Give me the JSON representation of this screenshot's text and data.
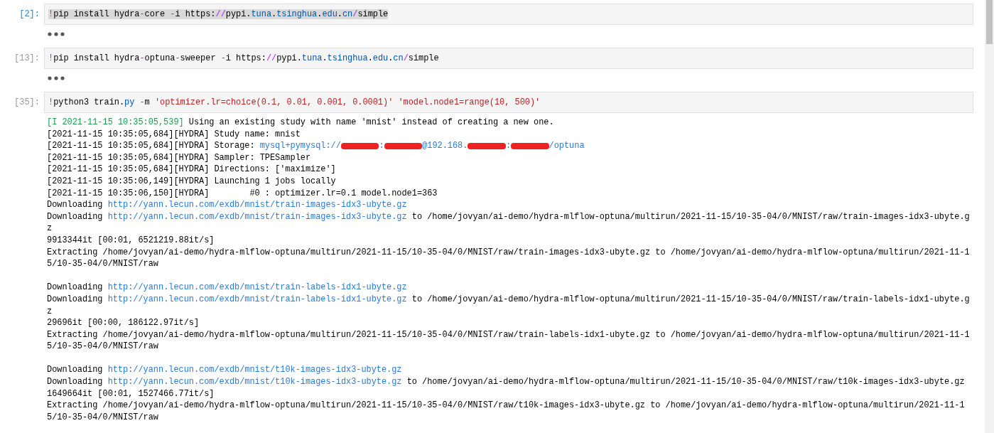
{
  "cells": [
    {
      "prompt": "[2]:",
      "selected": true,
      "code": [
        {
          "kind": "op",
          "text": "!"
        },
        {
          "kind": "plain",
          "text": "pip install hydra"
        },
        {
          "kind": "op",
          "text": "-"
        },
        {
          "kind": "plain",
          "text": "core "
        },
        {
          "kind": "op",
          "text": "-"
        },
        {
          "kind": "plain",
          "text": "i https:"
        },
        {
          "kind": "op",
          "text": "//"
        },
        {
          "kind": "plain",
          "text": "pypi."
        },
        {
          "kind": "name",
          "text": "tuna"
        },
        {
          "kind": "plain",
          "text": "."
        },
        {
          "kind": "name",
          "text": "tsinghua"
        },
        {
          "kind": "plain",
          "text": "."
        },
        {
          "kind": "name",
          "text": "edu"
        },
        {
          "kind": "plain",
          "text": "."
        },
        {
          "kind": "name",
          "text": "cn"
        },
        {
          "kind": "op",
          "text": "/"
        },
        {
          "kind": "plain",
          "text": "simple"
        }
      ],
      "output": {
        "collapsed": true
      }
    },
    {
      "prompt": "[13]:",
      "selected": false,
      "code": [
        {
          "kind": "op",
          "text": "!"
        },
        {
          "kind": "plain",
          "text": "pip install hydra"
        },
        {
          "kind": "op",
          "text": "-"
        },
        {
          "kind": "plain",
          "text": "optuna"
        },
        {
          "kind": "op",
          "text": "-"
        },
        {
          "kind": "plain",
          "text": "sweeper "
        },
        {
          "kind": "op",
          "text": "-"
        },
        {
          "kind": "plain",
          "text": "i https:"
        },
        {
          "kind": "op",
          "text": "//"
        },
        {
          "kind": "plain",
          "text": "pypi."
        },
        {
          "kind": "name",
          "text": "tuna"
        },
        {
          "kind": "plain",
          "text": "."
        },
        {
          "kind": "name",
          "text": "tsinghua"
        },
        {
          "kind": "plain",
          "text": "."
        },
        {
          "kind": "name",
          "text": "edu"
        },
        {
          "kind": "plain",
          "text": "."
        },
        {
          "kind": "name",
          "text": "cn"
        },
        {
          "kind": "op",
          "text": "/"
        },
        {
          "kind": "plain",
          "text": "simple"
        }
      ],
      "output": {
        "collapsed": true
      }
    },
    {
      "prompt": "[35]:",
      "selected": false,
      "code": [
        {
          "kind": "op",
          "text": "!"
        },
        {
          "kind": "plain",
          "text": "python3 train."
        },
        {
          "kind": "name",
          "text": "py"
        },
        {
          "kind": "op",
          "text": " -"
        },
        {
          "kind": "plain",
          "text": "m "
        },
        {
          "kind": "string",
          "text": "'optimizer.lr=choice(0.1, 0.01, 0.001, 0.0001)' 'model.node1=range(10, 500)'"
        }
      ],
      "output": {
        "collapsed": false,
        "groups": [
          {
            "lines": [
              [
                {
                  "kind": "log",
                  "text": "[I 2021-11-15 10:35:05,539]"
                },
                {
                  "kind": "text",
                  "text": " Using an existing study with name 'mnist' instead of creating a new one."
                }
              ],
              [
                {
                  "kind": "text",
                  "text": "[2021-11-15 10:35:05,684][HYDRA] Study name: mnist"
                }
              ],
              [
                {
                  "kind": "text",
                  "text": "[2021-11-15 10:35:05,684][HYDRA] Storage: "
                },
                {
                  "kind": "link",
                  "text": "mysql+pymysql://"
                },
                {
                  "kind": "redacted"
                },
                {
                  "kind": "link",
                  "text": ":"
                },
                {
                  "kind": "redacted"
                },
                {
                  "kind": "link",
                  "text": "@192.168."
                },
                {
                  "kind": "redacted"
                },
                {
                  "kind": "link",
                  "text": ":"
                },
                {
                  "kind": "redacted"
                },
                {
                  "kind": "link",
                  "text": "/optuna"
                }
              ],
              [
                {
                  "kind": "text",
                  "text": "[2021-11-15 10:35:05,684][HYDRA] Sampler: TPESampler"
                }
              ],
              [
                {
                  "kind": "text",
                  "text": "[2021-11-15 10:35:05,684][HYDRA] Directions: ['maximize']"
                }
              ],
              [
                {
                  "kind": "text",
                  "text": "[2021-11-15 10:35:06,149][HYDRA] Launching 1 jobs locally"
                }
              ],
              [
                {
                  "kind": "text",
                  "text": "[2021-11-15 10:35:06,150][HYDRA]        #0 : optimizer.lr=0.1 model.node1=363"
                }
              ],
              [
                {
                  "kind": "text",
                  "text": "Downloading "
                },
                {
                  "kind": "link",
                  "text": "http://yann.lecun.com/exdb/mnist/train-images-idx3-ubyte.gz"
                }
              ],
              [
                {
                  "kind": "text",
                  "text": "Downloading "
                },
                {
                  "kind": "link",
                  "text": "http://yann.lecun.com/exdb/mnist/train-images-idx3-ubyte.gz"
                },
                {
                  "kind": "text",
                  "text": " to /home/jovyan/ai-demo/hydra-mlflow-optuna/multirun/2021-11-15/10-35-04/0/MNIST/raw/train-images-idx3-ubyte.g"
                }
              ],
              [
                {
                  "kind": "text",
                  "text": "z"
                }
              ],
              [
                {
                  "kind": "text",
                  "text": "9913344it [00:01, 6521219.88it/s]"
                }
              ],
              [
                {
                  "kind": "text",
                  "text": "Extracting /home/jovyan/ai-demo/hydra-mlflow-optuna/multirun/2021-11-15/10-35-04/0/MNIST/raw/train-images-idx3-ubyte.gz to /home/jovyan/ai-demo/hydra-mlflow-optuna/multirun/2021-11-1"
                }
              ],
              [
                {
                  "kind": "text",
                  "text": "5/10-35-04/0/MNIST/raw"
                }
              ]
            ]
          },
          {
            "lines": [
              [
                {
                  "kind": "text",
                  "text": "Downloading "
                },
                {
                  "kind": "link",
                  "text": "http://yann.lecun.com/exdb/mnist/train-labels-idx1-ubyte.gz"
                }
              ],
              [
                {
                  "kind": "text",
                  "text": "Downloading "
                },
                {
                  "kind": "link",
                  "text": "http://yann.lecun.com/exdb/mnist/train-labels-idx1-ubyte.gz"
                },
                {
                  "kind": "text",
                  "text": " to /home/jovyan/ai-demo/hydra-mlflow-optuna/multirun/2021-11-15/10-35-04/0/MNIST/raw/train-labels-idx1-ubyte.g"
                }
              ],
              [
                {
                  "kind": "text",
                  "text": "z"
                }
              ],
              [
                {
                  "kind": "text",
                  "text": "29696it [00:00, 186122.97it/s]"
                }
              ],
              [
                {
                  "kind": "text",
                  "text": "Extracting /home/jovyan/ai-demo/hydra-mlflow-optuna/multirun/2021-11-15/10-35-04/0/MNIST/raw/train-labels-idx1-ubyte.gz to /home/jovyan/ai-demo/hydra-mlflow-optuna/multirun/2021-11-1"
                }
              ],
              [
                {
                  "kind": "text",
                  "text": "5/10-35-04/0/MNIST/raw"
                }
              ]
            ]
          },
          {
            "lines": [
              [
                {
                  "kind": "text",
                  "text": "Downloading "
                },
                {
                  "kind": "link",
                  "text": "http://yann.lecun.com/exdb/mnist/t10k-images-idx3-ubyte.gz"
                }
              ],
              [
                {
                  "kind": "text",
                  "text": "Downloading "
                },
                {
                  "kind": "link",
                  "text": "http://yann.lecun.com/exdb/mnist/t10k-images-idx3-ubyte.gz"
                },
                {
                  "kind": "text",
                  "text": " to /home/jovyan/ai-demo/hydra-mlflow-optuna/multirun/2021-11-15/10-35-04/0/MNIST/raw/t10k-images-idx3-ubyte.gz"
                }
              ],
              [
                {
                  "kind": "text",
                  "text": "1649664it [00:01, 1527466.77it/s]"
                }
              ],
              [
                {
                  "kind": "text",
                  "text": "Extracting /home/jovyan/ai-demo/hydra-mlflow-optuna/multirun/2021-11-15/10-35-04/0/MNIST/raw/t10k-images-idx3-ubyte.gz to /home/jovyan/ai-demo/hydra-mlflow-optuna/multirun/2021-11-1"
                }
              ],
              [
                {
                  "kind": "text",
                  "text": "5/10-35-04/0/MNIST/raw"
                }
              ]
            ]
          }
        ]
      }
    }
  ]
}
